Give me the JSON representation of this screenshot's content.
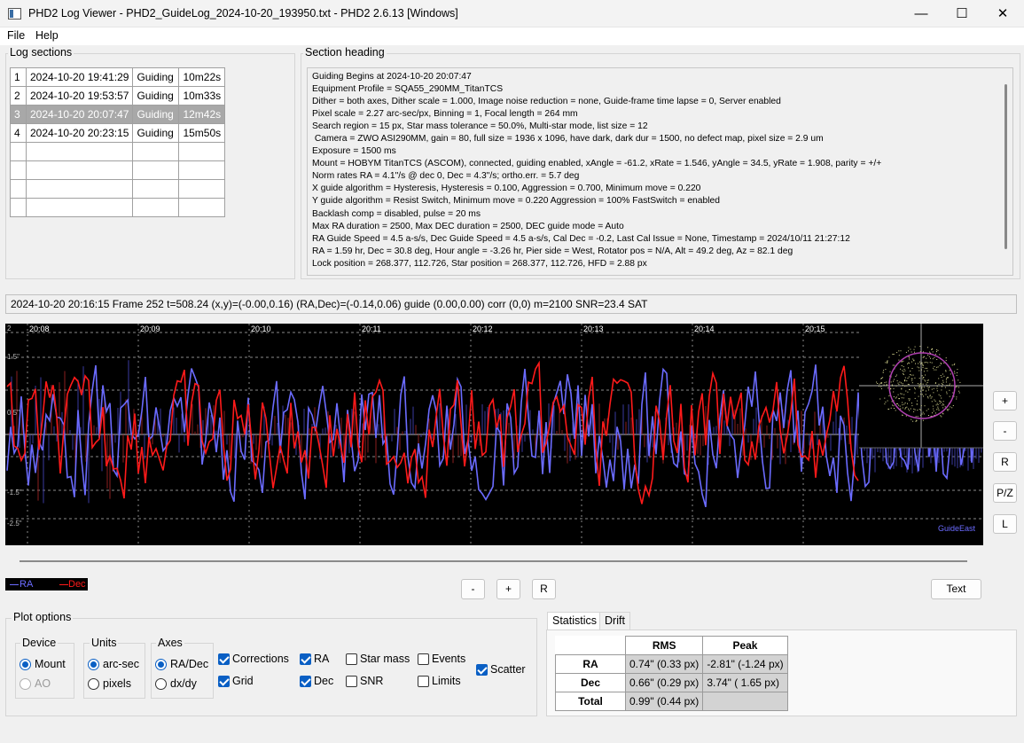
{
  "window": {
    "title": "PHD2 Log Viewer - PHD2_GuideLog_2024-10-20_193950.txt - PHD2 2.6.13 [Windows]",
    "minimize_glyph": "—",
    "maximize_glyph": "☐",
    "close_glyph": "✕"
  },
  "menu": {
    "file": "File",
    "help": "Help"
  },
  "log_sections": {
    "title": "Log sections",
    "rows": [
      {
        "num": "1",
        "time": "2024-10-20 19:41:29",
        "type": "Guiding",
        "duration": "10m22s"
      },
      {
        "num": "2",
        "time": "2024-10-20 19:53:57",
        "type": "Guiding",
        "duration": "10m33s"
      },
      {
        "num": "3",
        "time": "2024-10-20 20:07:47",
        "type": "Guiding",
        "duration": "12m42s"
      },
      {
        "num": "4",
        "time": "2024-10-20 20:23:15",
        "type": "Guiding",
        "duration": "15m50s"
      }
    ]
  },
  "section_heading": {
    "title": "Section heading",
    "lines": [
      "Guiding Begins at 2024-10-20 20:07:47",
      "Equipment Profile = SQA55_290MM_TitanTCS",
      "Dither = both axes, Dither scale = 1.000, Image noise reduction = none, Guide-frame time lapse = 0, Server enabled",
      "Pixel scale = 2.27 arc-sec/px, Binning = 1, Focal length = 264 mm",
      "Search region = 15 px, Star mass tolerance = 50.0%, Multi-star mode, list size = 12",
      " Camera = ZWO ASI290MM, gain = 80, full size = 1936 x 1096, have dark, dark dur = 1500, no defect map, pixel size = 2.9 um",
      "Exposure = 1500 ms",
      "Mount = HOBYM TitanTCS (ASCOM), connected, guiding enabled, xAngle = -61.2, xRate = 1.546, yAngle = 34.5, yRate = 1.908, parity = +/+",
      "Norm rates RA = 4.1\"/s @ dec 0, Dec = 4.3\"/s; ortho.err. = 5.7 deg",
      "X guide algorithm = Hysteresis, Hysteresis = 0.100, Aggression = 0.700, Minimum move = 0.220",
      "Y guide algorithm = Resist Switch, Minimum move = 0.220 Aggression = 100% FastSwitch = enabled",
      "Backlash comp = disabled, pulse = 20 ms",
      "Max RA duration = 2500, Max DEC duration = 2500, DEC guide mode = Auto",
      "RA Guide Speed = 4.5 a-s/s, Dec Guide Speed = 4.5 a-s/s, Cal Dec = -0.2, Last Cal Issue = None, Timestamp = 2024/10/11 21:27:12",
      "RA = 1.59 hr, Dec = 30.8 deg, Hour angle = -3.26 hr, Pier side = West, Rotator pos = N/A, Alt = 49.2 deg, Az = 82.1 deg",
      "Lock position = 268.377, 112.726, Star position = 268.377, 112.726, HFD = 2.88 px"
    ]
  },
  "status_line": "2024-10-20 20:16:15 Frame 252 t=508.24 (x,y)=(-0.00,0.16) (RA,Dec)=(-0.14,0.06) guide (0.00,0.00) corr (0,0) m=2100 SNR=23.4 SAT",
  "plot": {
    "time_labels": [
      "20:08",
      "20:09",
      "20:10",
      "20:11",
      "20:12",
      "20:13",
      "20:14",
      "20:15"
    ],
    "y_labels": [
      "2",
      "1.5\"",
      "0.5\"",
      "-1.5\"",
      "-2.5\""
    ],
    "corner_label": "GuideEast",
    "colors": {
      "ra": "#6b6bff",
      "dec": "#ff1a1a",
      "background": "#000000",
      "grid": "#8a8a8a",
      "scatter": "#d8d890",
      "circle": "#b040b0"
    }
  },
  "side_buttons": {
    "zoom_in": "+",
    "zoom_out": "-",
    "reset": "R",
    "pz": "P/Z",
    "lock": "L"
  },
  "bottom_buttons": {
    "minus": "-",
    "plus": "+",
    "reset": "R",
    "text": "Text"
  },
  "legend": {
    "ra": "RA",
    "dec": "Dec"
  },
  "plot_options": {
    "title": "Plot options",
    "device": {
      "title": "Device",
      "mount": "Mount",
      "ao": "AO"
    },
    "units": {
      "title": "Units",
      "arcsec": "arc-sec",
      "pixels": "pixels"
    },
    "axes": {
      "title": "Axes",
      "radec": "RA/Dec",
      "dxdy": "dx/dy"
    },
    "checks": {
      "corrections": "Corrections",
      "grid": "Grid",
      "ra": "RA",
      "dec": "Dec",
      "star_mass": "Star mass",
      "snr": "SNR",
      "events": "Events",
      "limits": "Limits",
      "scatter": "Scatter"
    }
  },
  "tabs": {
    "statistics": "Statistics",
    "drift": "Drift"
  },
  "statistics": {
    "headers": {
      "rms": "RMS",
      "peak": "Peak"
    },
    "rows": [
      {
        "label": "RA",
        "rms": "0.74\" (0.33 px)",
        "peak": "-2.81\" (-1.24 px)"
      },
      {
        "label": "Dec",
        "rms": "0.66\" (0.29 px)",
        "peak": "3.74\" ( 1.65 px)"
      },
      {
        "label": "Total",
        "rms": "0.99\" (0.44 px)",
        "peak": ""
      }
    ]
  }
}
